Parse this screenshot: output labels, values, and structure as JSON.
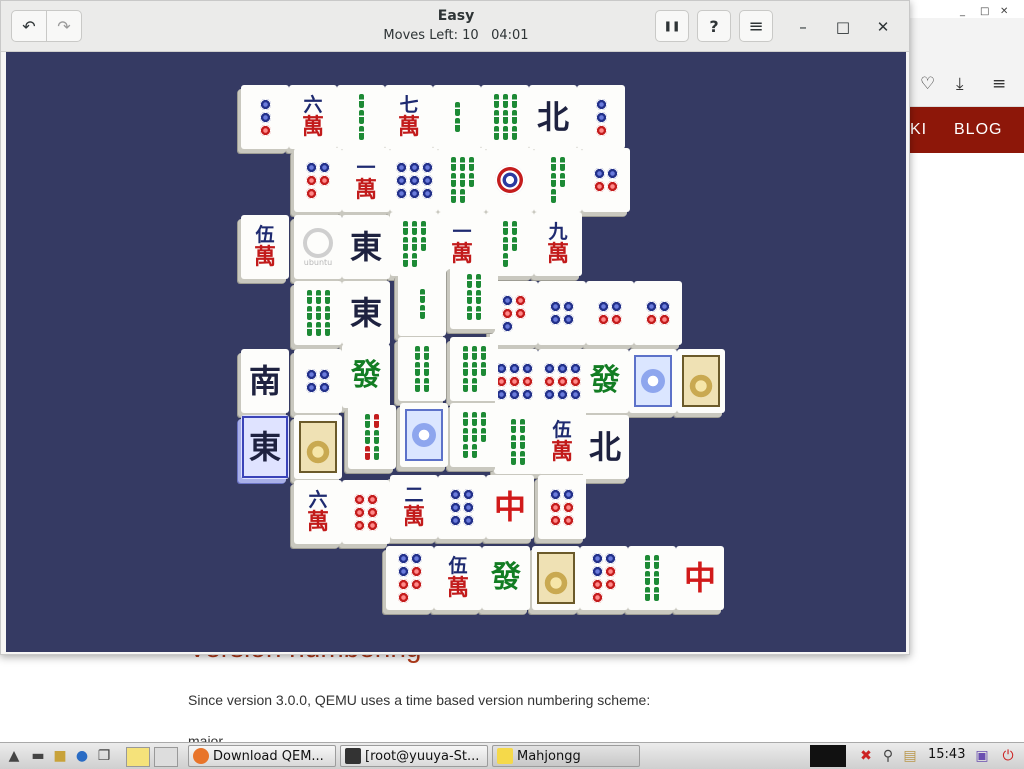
{
  "window": {
    "title": "Easy",
    "subtitle": "Moves Left: 10   04:01",
    "buttons": {
      "undo": "↶",
      "redo": "↷",
      "pause": "❚❚",
      "hint": "?",
      "menu": "≡",
      "minimize": "–",
      "maximize": "□",
      "close": "✕"
    }
  },
  "browser": {
    "titlebar_buttons": [
      "_",
      "□",
      "✕"
    ],
    "toolbar_icons": [
      "pocket-icon",
      "download-icon",
      "menu-icon"
    ],
    "toolbar_glyphs": [
      "♡",
      "⤓",
      "≡"
    ],
    "nav": {
      "item_partial": "KI",
      "item_blog": "BLOG"
    },
    "heading": "Version numbering",
    "paragraph": "Since version 3.0.0, QEMU uses a time based version numbering scheme:",
    "paragraph2": "major"
  },
  "tiles": [
    {
      "kind": "dots",
      "n": 3,
      "c": "bbr"
    },
    {
      "kind": "wan",
      "num": "六"
    },
    {
      "kind": "bam",
      "n": 3
    },
    {
      "kind": "wan",
      "num": "七"
    },
    {
      "kind": "bam",
      "n": 2
    },
    {
      "kind": "bam",
      "n": 9
    },
    {
      "kind": "wind",
      "ch": "北"
    },
    {
      "kind": "dots",
      "n": 3,
      "c": "bbr"
    },
    {
      "kind": "dots",
      "n": 5,
      "c": "bbrrr"
    },
    {
      "kind": "wan",
      "num": "一"
    },
    {
      "kind": "dots",
      "n": 9,
      "c": "bbbbbbbbb"
    },
    {
      "kind": "bam",
      "n": 8
    },
    {
      "kind": "onedot"
    },
    {
      "kind": "bam",
      "n": 5
    },
    {
      "kind": "dots",
      "n": 4,
      "c": "bbrr"
    },
    {
      "kind": "wan",
      "num": "伍"
    },
    {
      "kind": "ubuntu",
      "label": "ubuntu"
    },
    {
      "kind": "wind",
      "ch": "東"
    },
    {
      "kind": "bam",
      "n": 8
    },
    {
      "kind": "wan",
      "num": "一"
    },
    {
      "kind": "bam",
      "n": 5
    },
    {
      "kind": "wan",
      "num": "九"
    },
    {
      "kind": "bam",
      "n": 9
    },
    {
      "kind": "wind",
      "ch": "東"
    },
    {
      "kind": "bam",
      "n": 2
    },
    {
      "kind": "bam",
      "n": 6
    },
    {
      "kind": "dots",
      "n": 5,
      "c": "brrrb"
    },
    {
      "kind": "dots",
      "n": 4,
      "c": "bbbb"
    },
    {
      "kind": "dots",
      "n": 4,
      "c": "bbrr"
    },
    {
      "kind": "dots",
      "n": 4,
      "c": "bbrr"
    },
    {
      "kind": "wind",
      "ch": "南"
    },
    {
      "kind": "dots",
      "n": 4,
      "c": "bbbb"
    },
    {
      "kind": "green",
      "ch": "發"
    },
    {
      "kind": "bam",
      "n": 6
    },
    {
      "kind": "bam",
      "n": 8
    },
    {
      "kind": "dots",
      "n": 9,
      "c": "bbbrrrbbb"
    },
    {
      "kind": "dots",
      "n": 9,
      "c": "bbbrrrbbb"
    },
    {
      "kind": "green",
      "ch": "發"
    },
    {
      "kind": "season"
    },
    {
      "kind": "flower"
    },
    {
      "kind": "wind",
      "ch": "東"
    },
    {
      "kind": "flower"
    },
    {
      "kind": "bam",
      "n": 6,
      "red": true
    },
    {
      "kind": "season"
    },
    {
      "kind": "bam",
      "n": 8
    },
    {
      "kind": "bam",
      "n": 6
    },
    {
      "kind": "wan",
      "num": "伍"
    },
    {
      "kind": "wind",
      "ch": "北"
    },
    {
      "kind": "wan",
      "num": "六"
    },
    {
      "kind": "dots",
      "n": 6,
      "c": "rrrrrr"
    },
    {
      "kind": "wan",
      "num": "二"
    },
    {
      "kind": "dots",
      "n": 6,
      "c": "bbbbbb"
    },
    {
      "kind": "red",
      "ch": "中"
    },
    {
      "kind": "dots",
      "n": 6,
      "c": "bbrrrr"
    },
    {
      "kind": "dots",
      "n": 7,
      "c": "bbbrrrr"
    },
    {
      "kind": "wan",
      "num": "伍"
    },
    {
      "kind": "green",
      "ch": "發"
    },
    {
      "kind": "flower"
    },
    {
      "kind": "dots",
      "n": 7,
      "c": "bbbrrrr"
    },
    {
      "kind": "bam",
      "n": 6
    },
    {
      "kind": "red",
      "ch": "中"
    }
  ],
  "wan_char": "萬",
  "taskbar": {
    "tasks": [
      {
        "label": "Download QEM...",
        "color": "#e8742a"
      },
      {
        "label": "[root@yuuya-St...",
        "color": "#333333"
      },
      {
        "label": "Mahjongg",
        "color": "#f5d94a"
      }
    ],
    "clock": "15:43"
  }
}
